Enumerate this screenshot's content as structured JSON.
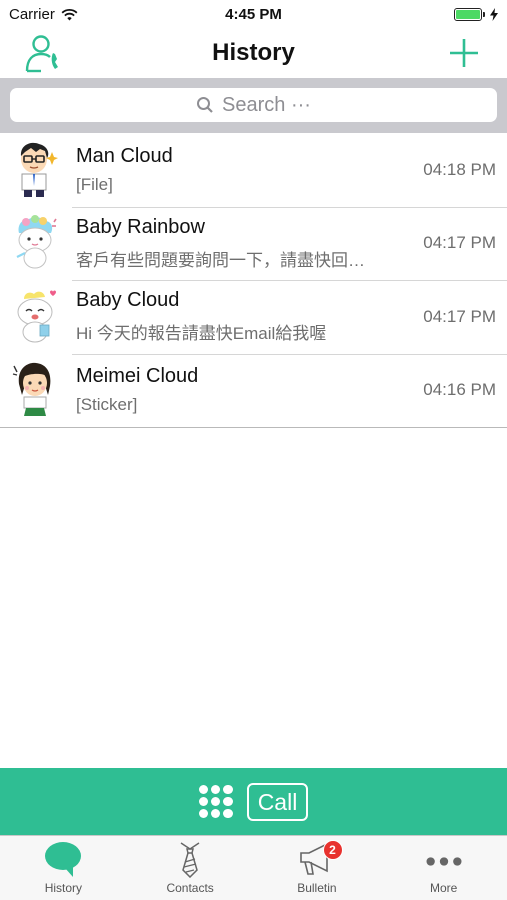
{
  "status_bar": {
    "carrier": "Carrier",
    "time": "4:45 PM",
    "wifi_icon": "wifi-icon",
    "battery_icon": "battery-icon",
    "charging_icon": "charging-bolt-icon"
  },
  "nav": {
    "title": "History",
    "left_icon": "contact-phone-icon",
    "right_icon": "plus-icon"
  },
  "search": {
    "placeholder": "Search ···",
    "icon": "search-icon"
  },
  "history": [
    {
      "name": "Man Cloud",
      "message": "[File]",
      "time": "04:18 PM",
      "avatar": "man-cloud-avatar"
    },
    {
      "name": "Baby Rainbow",
      "message": "客戶有些問題要詢問一下，請盡快回…",
      "time": "04:17 PM",
      "avatar": "baby-rainbow-avatar"
    },
    {
      "name": "Baby Cloud",
      "message": "Hi 今天的報告請盡快Email給我喔",
      "time": "04:17 PM",
      "avatar": "baby-cloud-avatar"
    },
    {
      "name": "Meimei Cloud",
      "message": "[Sticker]",
      "time": "04:16 PM",
      "avatar": "meimei-cloud-avatar"
    }
  ],
  "call_bar": {
    "label": "Call",
    "keypad_icon": "keypad-icon"
  },
  "tabs": [
    {
      "label": "History",
      "icon": "chat-bubble-icon",
      "active": true
    },
    {
      "label": "Contacts",
      "icon": "tie-icon",
      "active": false
    },
    {
      "label": "Bulletin",
      "icon": "megaphone-icon",
      "active": false,
      "badge": "2"
    },
    {
      "label": "More",
      "icon": "more-dots-icon",
      "active": false
    }
  ],
  "colors": {
    "accent": "#2fbe93",
    "badge": "#e8322e",
    "search_bg": "#c9c9ce",
    "tab_bar_bg": "#f7f7f7"
  }
}
